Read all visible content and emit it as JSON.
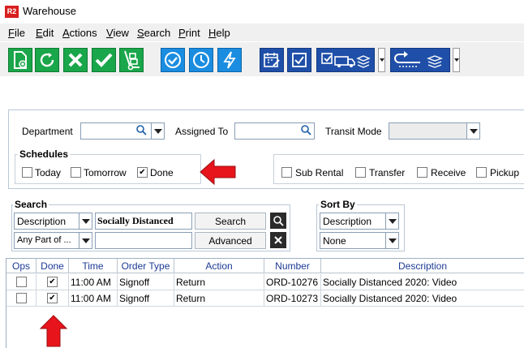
{
  "window": {
    "icon_text": "R2",
    "title": "Warehouse"
  },
  "menu": [
    "File",
    "Edit",
    "Actions",
    "View",
    "Search",
    "Print",
    "Help"
  ],
  "menu_underline": [
    "F",
    "E",
    "A",
    "V",
    "S",
    "P",
    "H"
  ],
  "toolbar_icons": [
    "new-document-icon",
    "refresh-icon",
    "delete-icon",
    "check-icon",
    "hand-truck-icon",
    "check-circle-icon",
    "clock-icon",
    "lightning-icon",
    "calendar-edit-icon",
    "checkbox-icon",
    "truck-delivery-icon",
    "return-icon"
  ],
  "filters": {
    "department_label": "Department",
    "assigned_to_label": "Assigned To",
    "transit_mode_label": "Transit Mode",
    "schedules_title": "Schedules",
    "schedule_options": [
      {
        "label": "Today",
        "checked": false
      },
      {
        "label": "Tomorrow",
        "checked": false
      },
      {
        "label": "Done",
        "checked": true
      }
    ],
    "type_options": [
      {
        "label": "Sub Rental",
        "checked": false
      },
      {
        "label": "Transfer",
        "checked": false
      },
      {
        "label": "Receive",
        "checked": false
      },
      {
        "label": "Pickup",
        "checked": false
      }
    ]
  },
  "search": {
    "title": "Search",
    "field": "Description",
    "match": "Any Part of ...",
    "query": "Socially Distanced",
    "search_button": "Search",
    "advanced_button": "Advanced"
  },
  "sort": {
    "title": "Sort By",
    "primary": "Description",
    "secondary": "None"
  },
  "table": {
    "headers": [
      "Ops",
      "Done",
      "Time",
      "Order Type",
      "Action",
      "Number",
      "Description"
    ],
    "rows": [
      {
        "ops": false,
        "done": true,
        "time": "11:00 AM",
        "order_type": "Signoff",
        "action": "Return",
        "number": "ORD-10276",
        "description": "Socially Distanced 2020: Video"
      },
      {
        "ops": false,
        "done": true,
        "time": "11:00 AM",
        "order_type": "Signoff",
        "action": "Return",
        "number": "ORD-10273",
        "description": "Socially Distanced 2020: Video"
      }
    ]
  },
  "colors": {
    "annotation_arrow": "#e8141b",
    "header_text": "#1c3a96",
    "toolbar_green": "#1aa64a",
    "toolbar_blue": "#1a8de0",
    "toolbar_navy": "#1f4fa8"
  }
}
